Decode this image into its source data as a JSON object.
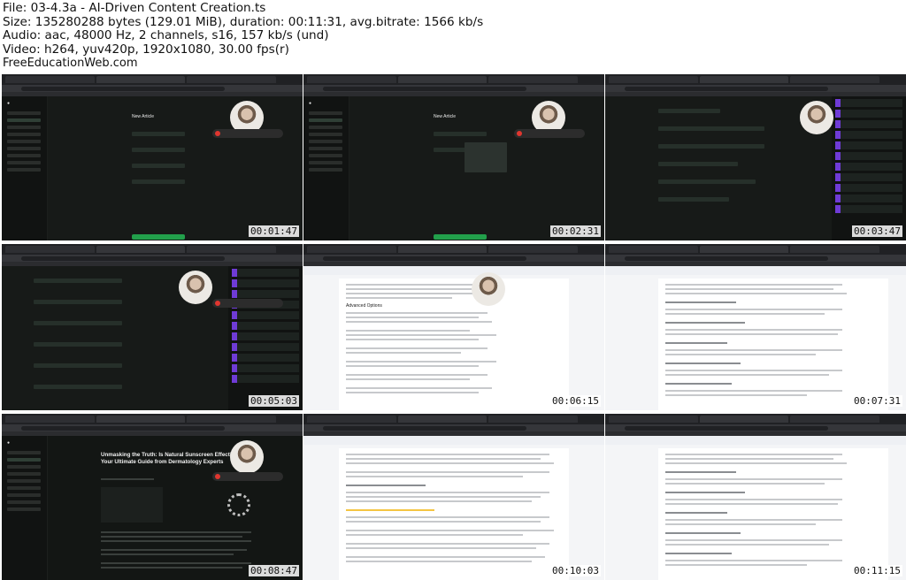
{
  "file_info": {
    "line1": "File: 03-4.3a - AI-Driven Content Creation.ts",
    "line2": "Size: 135280288 bytes (129.01 MiB), duration: 00:11:31, avg.bitrate: 1566 kb/s",
    "line3": "Audio: aac, 48000 Hz, 2 channels, s16, 157 kb/s (und)",
    "line4": "Video: h264, yuv420p, 1920x1080, 30.00 fps(r)",
    "watermark": "FreeEducationWeb.com"
  },
  "tiles": [
    {
      "timestamp": "00:01:47",
      "kind": "dark-form",
      "title": "New Article"
    },
    {
      "timestamp": "00:02:31",
      "kind": "dark-form",
      "title": "New Article"
    },
    {
      "timestamp": "00:03:47",
      "kind": "dark-outline",
      "title": ""
    },
    {
      "timestamp": "00:05:03",
      "kind": "dark-outline",
      "title": ""
    },
    {
      "timestamp": "00:06:15",
      "kind": "document",
      "title": "Advanced Options"
    },
    {
      "timestamp": "00:07:31",
      "kind": "document",
      "title": ""
    },
    {
      "timestamp": "00:08:47",
      "kind": "article",
      "title": "Unmasking the Truth: Is Natural Sunscreen Effective? Your Ultimate Guide from Dermatology Experts"
    },
    {
      "timestamp": "00:10:03",
      "kind": "document",
      "title": ""
    },
    {
      "timestamp": "00:11:15",
      "kind": "document",
      "title": ""
    }
  ],
  "colors": {
    "dark_bg": "#0f1110",
    "accent_green": "#22a04b",
    "accent_purple": "#6f3bd6",
    "record_red": "#e0362f"
  }
}
